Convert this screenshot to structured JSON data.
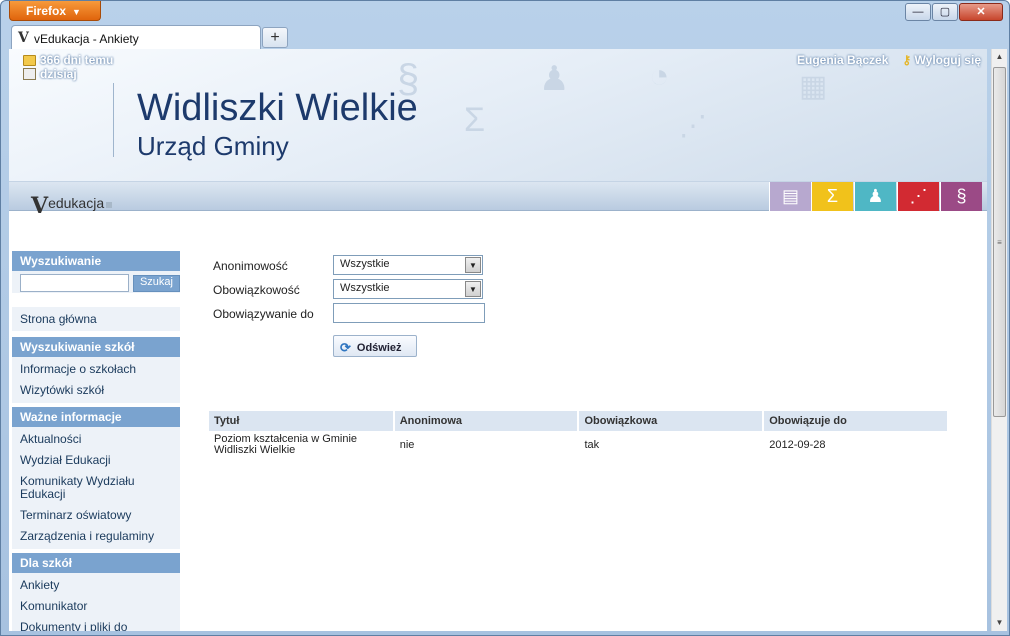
{
  "browser": {
    "menu_label": "Firefox",
    "tab_title": "vEdukacja - Ankiety",
    "new_tab": "+",
    "favicon": "V",
    "controls": {
      "minimize": "—",
      "maximize": "▢",
      "close": "✕"
    }
  },
  "header": {
    "messages": {
      "line1": "366 dni temu",
      "line2": "dzisiaj"
    },
    "user_name": "Eugenia Bączek",
    "logout_label": "Wyloguj się",
    "title": "Widliszki Wielkie",
    "subtitle": "Urząd Gminy"
  },
  "nav": {
    "logo_v": "V",
    "logo_text": "edukacja",
    "modules": [
      {
        "icon": "books-icon",
        "glyph": "▤",
        "color": "#b7a8cf"
      },
      {
        "icon": "sigma-icon",
        "glyph": "Σ",
        "color": "#f1c21b"
      },
      {
        "icon": "people-buildings-icon",
        "glyph": "♟",
        "color": "#4fb7c5"
      },
      {
        "icon": "share-icon",
        "glyph": "⋰",
        "color": "#d22a32"
      },
      {
        "icon": "paragraph-icon",
        "glyph": "§",
        "color": "#9b4a86"
      }
    ]
  },
  "sidebar": {
    "search": {
      "title": "Wyszukiwanie",
      "button": "Szukaj",
      "value": ""
    },
    "home": "Strona główna",
    "sections": [
      {
        "title": "Wyszukiwanie szkół",
        "items": [
          "Informacje o szkołach",
          "Wizytówki szkół"
        ]
      },
      {
        "title": "Ważne informacje",
        "items": [
          "Aktualności",
          "Wydział Edukacji",
          "Komunikaty Wydziału Edukacji",
          "Terminarz oświatowy",
          "Zarządzenia i regulaminy"
        ]
      },
      {
        "title": "Dla szkół",
        "items": [
          "Ankiety",
          "Komunikator",
          "Dokumenty i pliki do pobrania"
        ]
      }
    ]
  },
  "filters": {
    "anonymity": {
      "label": "Anonimowość",
      "value": "Wszystkie"
    },
    "obligation": {
      "label": "Obowiązkowość",
      "value": "Wszystkie"
    },
    "valid_until": {
      "label": "Obowiązywanie do",
      "value": ""
    },
    "refresh": "Odśwież"
  },
  "table": {
    "headers": [
      "Tytuł",
      "Anonimowa",
      "Obowiązkowa",
      "Obowiązuje do"
    ],
    "rows": [
      [
        "Poziom kształcenia w Gminie Widliszki Wielkie",
        "nie",
        "tak",
        "2012-09-28"
      ]
    ]
  }
}
